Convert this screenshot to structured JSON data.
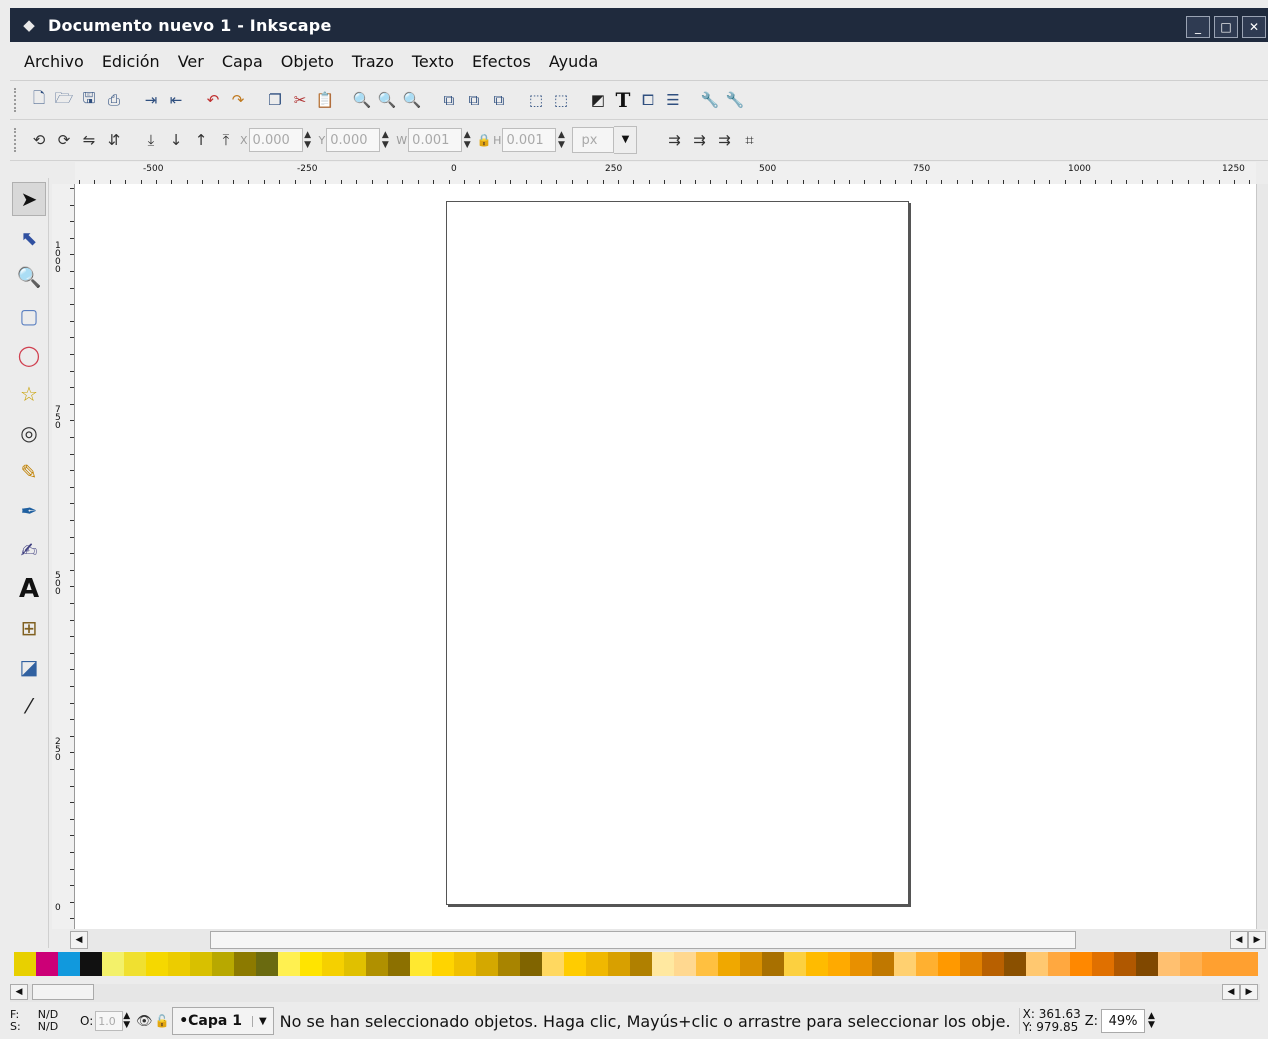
{
  "window": {
    "title": "Documento nuevo 1 - Inkscape",
    "buttons": [
      "_",
      "□",
      "✕"
    ]
  },
  "menu": [
    "Archivo",
    "Edición",
    "Ver",
    "Capa",
    "Objeto",
    "Trazo",
    "Texto",
    "Efectos",
    "Ayuda"
  ],
  "toolbar": {
    "x": {
      "label": "X",
      "value": "0.000"
    },
    "y": {
      "label": "Y",
      "value": "0.000"
    },
    "w": {
      "label": "W",
      "value": "0.001"
    },
    "h": {
      "label": "H",
      "value": "0.001"
    },
    "unit": "px"
  },
  "ruler": {
    "h_labels": [
      "-500",
      "-250",
      "0",
      "250",
      "500",
      "750",
      "1000",
      "1250"
    ],
    "v_labels": [
      "1000",
      "750",
      "500",
      "250",
      "0"
    ]
  },
  "status": {
    "fill_label": "F:",
    "fill_value": "N/D",
    "stroke_label": "S:",
    "stroke_value": "N/D",
    "opacity_label": "O:",
    "opacity_value": "1.0",
    "layer": "•Capa 1",
    "message": "No se han seleccionado objetos. Haga clic, Mayús+clic o arrastre para seleccionar los obje.",
    "x": "X: 361.63",
    "y": "Y: 979.85",
    "zoom_label": "Z:",
    "zoom_value": "49%"
  },
  "palette": [
    "#e8d000",
    "#cc0077",
    "#1199dd",
    "#111111",
    "#f3f16a",
    "#f0e030",
    "#f5d800",
    "#eccc00",
    "#d8c000",
    "#b8a800",
    "#8c7a00",
    "#6a6a10",
    "#fff050",
    "#ffe400",
    "#f5d000",
    "#e0c000",
    "#b09000",
    "#8c7000",
    "#ffe830",
    "#ffd400",
    "#f0c000",
    "#d4a800",
    "#a88400",
    "#806400",
    "#ffd860",
    "#ffcc00",
    "#f0b800",
    "#d8a000",
    "#b08000",
    "#ffe8a0",
    "#ffd890",
    "#ffc040",
    "#f0a800",
    "#d89000",
    "#a87000",
    "#fcd040",
    "#ffbb00",
    "#ffaa00",
    "#e89000",
    "#c07800",
    "#ffd070",
    "#ffb030",
    "#ff9900",
    "#e08000",
    "#b86000",
    "#8a5000",
    "#ffc870",
    "#ffa840",
    "#ff8800",
    "#e07000",
    "#b05800",
    "#804800",
    "#ffc070",
    "#ffb050",
    "#ffa030"
  ]
}
